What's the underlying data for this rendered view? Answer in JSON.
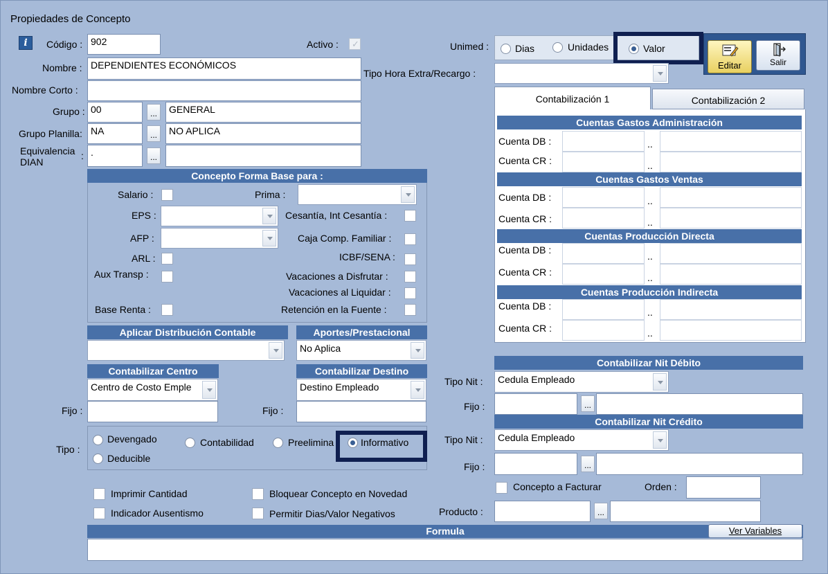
{
  "window": {
    "title": "Propiedades de Concepto"
  },
  "general": {
    "info_glyph": "i",
    "codigo_label": "Código :",
    "codigo_value": "902",
    "activo_label": "Activo :",
    "nombre_label": "Nombre :",
    "nombre_value": "DEPENDIENTES ECONÓMICOS",
    "nombre_corto_label": "Nombre Corto :",
    "nombre_corto_value": "",
    "grupo_label": "Grupo :",
    "grupo_code": "00",
    "grupo_name": "GENERAL",
    "grupo_planilla_label": "Grupo Planilla:",
    "grupo_planilla_code": "NA",
    "grupo_planilla_name": "NO APLICA",
    "equivalencia_label_1": "Equivalencia",
    "equivalencia_label_2": "DIAN",
    "equivalencia_colon": ":",
    "equivalencia_code": ".",
    "equivalencia_name": "",
    "ellipsis": "..."
  },
  "unimed": {
    "label": "Unimed :",
    "options": [
      "Dias",
      "Unidades",
      "Valor"
    ],
    "selected": "Valor",
    "tipo_hora_label": "Tipo Hora Extra/Recargo :",
    "tipo_hora_value": ""
  },
  "toolbar": {
    "edit_label": "Editar",
    "exit_label": "Salir",
    "edit_icon": "edit-icon",
    "exit_icon": "exit-icon"
  },
  "forma_base": {
    "header": "Concepto Forma Base para :",
    "salario": "Salario :",
    "prima": "Prima :",
    "eps": "EPS :",
    "cesantia": "Cesantía, Int Cesantía :",
    "afp": "AFP :",
    "caja": "Caja Comp. Familiar :",
    "arl": "ARL :",
    "icbf": "ICBF/SENA :",
    "aux": "Aux Transp :",
    "vac_disf": "Vacaciones a Disfrutar :",
    "vac_liq": "Vacaciones al Liquidar :",
    "base_renta": "Base Renta :",
    "retencion": "Retención en la Fuente :"
  },
  "distribucion": {
    "header": "Aplicar Distribución Contable",
    "value": ""
  },
  "aportes": {
    "header": "Aportes/Prestacional",
    "value": "No Aplica"
  },
  "centro": {
    "header": "Contabilizar Centro",
    "value": "Centro de Costo Emple",
    "fijo_label": "Fijo :",
    "fijo_value": ""
  },
  "destino": {
    "header": "Contabilizar Destino",
    "value": "Destino Empleado",
    "fijo_label": "Fijo :",
    "fijo_value": ""
  },
  "tipo": {
    "label": "Tipo :",
    "options": [
      "Devengado",
      "Contabilidad",
      "Preelimina",
      "Informativo",
      "Deducible"
    ],
    "selected": "Informativo"
  },
  "checks": {
    "imprimir": "Imprimir Cantidad",
    "ausentismo": "Indicador Ausentismo",
    "bloquear": "Bloquear Concepto en Novedad",
    "permitir": "Permitir Dias/Valor Negativos"
  },
  "formula": {
    "header": "Formula",
    "ver_variables": "Ver Variables",
    "value": ""
  },
  "contab_tabs": [
    "Contabilización 1",
    "Contabilización 2"
  ],
  "cuentas": {
    "db_label": "Cuenta DB :",
    "cr_label": "Cuenta CR :",
    "sep": "..",
    "groups": [
      "Cuentas Gastos Administración",
      "Cuentas Gastos Ventas",
      "Cuentas Producción Directa",
      "Cuentas Producción Indirecta"
    ]
  },
  "nit_debito": {
    "header": "Contabilizar Nit Débito",
    "tipo_label": "Tipo Nit :",
    "tipo_value": "Cedula Empleado",
    "fijo_label": "Fijo :"
  },
  "nit_credito": {
    "header": "Contabilizar Nit Crédito",
    "tipo_label": "Tipo Nit :",
    "tipo_value": "Cedula Empleado",
    "fijo_label": "Fijo :"
  },
  "facturar": {
    "label": "Concepto a Facturar",
    "orden_label": "Orden :",
    "orden_value": "",
    "producto_label": "Producto :",
    "ellipsis": "..."
  },
  "colors": {
    "window_bg": "#a6bad8",
    "header_bg": "#4870a8",
    "highlight": "#0f1f50"
  }
}
